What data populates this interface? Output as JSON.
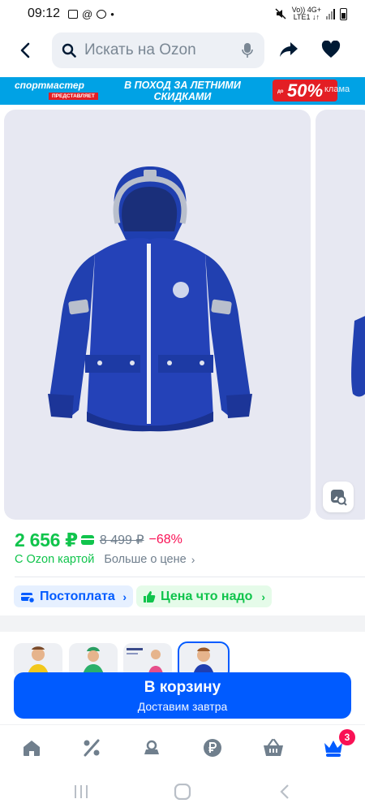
{
  "status_bar": {
    "time": "09:12",
    "network_line1": "Vo)) 4G+",
    "network_line2": "LTE1 ↓↑"
  },
  "search": {
    "placeholder": "Искать на Ozon"
  },
  "banner": {
    "brand": "спортмастер",
    "brand_sub": "ПРЕДСТАВЛЯЕТ",
    "slogan_line1": "В ПОХОД ЗА ЛЕТНИМИ",
    "slogan_line2": "СКИДКАМИ",
    "discount_prefix": "до",
    "discount": "50%",
    "ad_label": "клама"
  },
  "product": {
    "price": "2 656 ₽",
    "old_price": "8 499 ₽",
    "discount": "−68%",
    "ozon_card_label": "С Ozon картой",
    "more_price_label": "Больше о цене",
    "badges": [
      {
        "label": "Постоплата"
      },
      {
        "label": "Цена что надо"
      }
    ]
  },
  "cta": {
    "title": "В корзину",
    "subtitle": "Доставим завтра"
  },
  "tabbar": {
    "cart_count": "3"
  },
  "colors": {
    "ozon_blue": "#005bff",
    "price_green": "#10c44c",
    "discount_pink": "#f91155",
    "jacket_blue": "#1f3fb0"
  }
}
